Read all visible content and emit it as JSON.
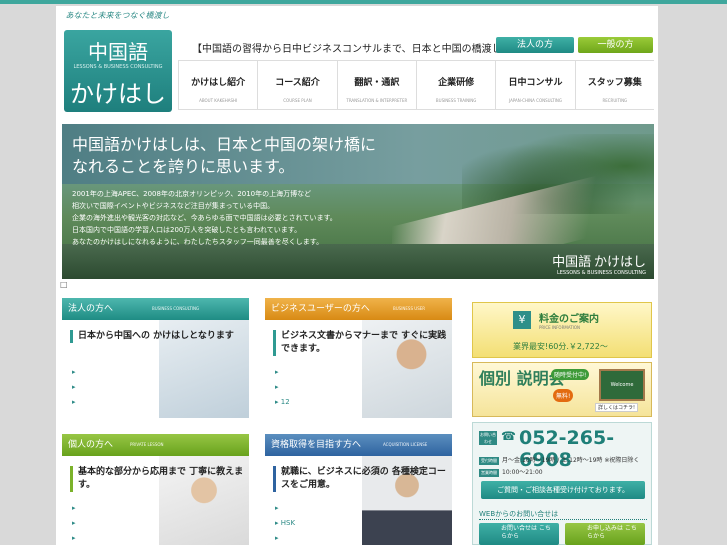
{
  "header": {
    "tagline": "あなたと未来をつなぐ橋渡し",
    "logo_jp": "中国語",
    "logo_en": "LESSONS & BUSINESS CONSULTING",
    "logo_kana": "かけはし",
    "headline": "【中国語の習得から日中ビジネスコンサルまで、日本と中国の橋渡しに】",
    "corporate_btn": "法人の方",
    "individual_btn": "一般の方"
  },
  "nav": [
    {
      "label": "かけはし紹介",
      "sub": "ABOUT KAKEHASHI"
    },
    {
      "label": "コース紹介",
      "sub": "COURSE PLAN"
    },
    {
      "label": "翻訳・通訳",
      "sub": "TRANSLATION & INTERPRETER"
    },
    {
      "label": "企業研修",
      "sub": "BUSINESS TRAINING"
    },
    {
      "label": "日中コンサル",
      "sub": "JAPAN-CHINA CONSULTING"
    },
    {
      "label": "スタッフ募集",
      "sub": "RECRUITING"
    }
  ],
  "hero": {
    "title": "中国語かけはしは、日本と中国の架け橋に なれることを誇りに思います。",
    "lines": [
      "2001年の上海APEC、2008年の北京オリンピック、2010年の上海万博など",
      "相次いで国際イベントやビジネスなど注目が集まっている中国。",
      "企業の海外進出や観光客の対応など、今あらゆる面で中国語は必要とされています。",
      "日本国内で中国語の学習人口は200万人を突破したとも言われています。",
      "あなたのかけはしになれるように、わたしたちスタッフ一同最善を尽くします。"
    ],
    "mark_jp": "中国語",
    "mark_kana": "かけはし",
    "mark_en": "LESSONS & BUSINESS CONSULTING"
  },
  "glyph": "□",
  "cards": [
    {
      "title": "法人の方へ",
      "sub": "BUSINESS CONSULTING",
      "heading": "日本から中国への かけはしとなります",
      "links": [
        "",
        "",
        ""
      ]
    },
    {
      "title": "ビジネスユーザーの方へ",
      "sub": "BUSINESS USER",
      "heading": "ビジネス文書からマナーまで すぐに実践できます。",
      "links": [
        "",
        "",
        "12"
      ]
    },
    {
      "title": "個人の方へ",
      "sub": "PRIVATE LESSON",
      "heading": "基本的な部分から応用まで 丁寧に教えます。",
      "links": [
        "",
        "",
        ""
      ]
    },
    {
      "title": "資格取得を目指す方へ",
      "sub": "ACQUISITION LICENSE",
      "heading": "就職に、ビジネスに必須の 各種検定コースをご用意。",
      "links": [
        "",
        "HSK",
        ""
      ]
    }
  ],
  "price": {
    "icon": "¥",
    "title": "料金のご案内",
    "sub": "PRICE INFORMATION",
    "text": "業界最安!60分.￥2,722〜"
  },
  "seminar": {
    "title": "個別 説明会",
    "badge1": "随時受付中!",
    "badge2": "無料!",
    "board": "Welcome",
    "detail": "詳しくはコチラ!"
  },
  "contact": {
    "label": "お問い合わせ",
    "phone_icon": "☎",
    "tel": "052-265-6908",
    "hours_label": "受付時間",
    "hours": "月〜金:10時〜19時 / 土:12時〜19時 ※祝際日除く",
    "open_label": "営業時間",
    "open": "10:00〜21:00",
    "cta": "ご質問・ご相談各種受け付けております。",
    "web": "WEBからのお問い合せは",
    "web1": "お問い合せは こちらから",
    "web2": "お申し込みは こちらから"
  }
}
